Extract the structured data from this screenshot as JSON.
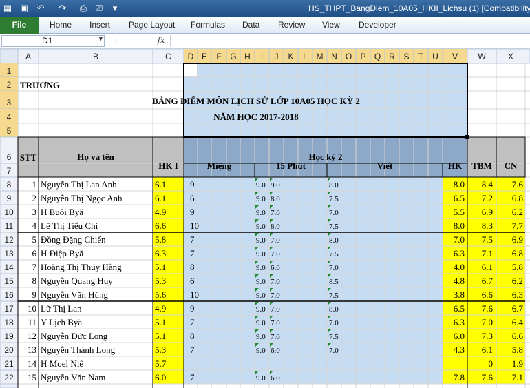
{
  "window": {
    "title": "HS_THPT_BangDiem_10A05_HKII_Lichsu (1)  [Compatibility"
  },
  "quick_access": {
    "save_icon": "save-icon",
    "undo_icon": "undo-icon",
    "redo_icon": "redo-icon",
    "print_preview_icon": "print-preview-icon",
    "print_icon": "print-icon",
    "customize_icon": "chevron-down-icon"
  },
  "ribbon": {
    "file_label": "File",
    "tabs": [
      "Home",
      "Insert",
      "Page Layout",
      "Formulas",
      "Data",
      "Review",
      "View",
      "Developer"
    ]
  },
  "formula_bar": {
    "name_box": "D1",
    "fx_label": "fx",
    "formula": ""
  },
  "columns": [
    "A",
    "B",
    "C",
    "D",
    "E",
    "F",
    "G",
    "H",
    "I",
    "J",
    "K",
    "L",
    "M",
    "N",
    "O",
    "P",
    "Q",
    "R",
    "S",
    "T",
    "U",
    "V",
    "W",
    "X"
  ],
  "row_numbers": [
    "1",
    "2",
    "3",
    "4",
    "5",
    "6",
    "7",
    "8",
    "9",
    "10",
    "11",
    "12",
    "13",
    "14",
    "15",
    "16",
    "17",
    "18",
    "19",
    "20",
    "21",
    "22"
  ],
  "sheet": {
    "school_label": "TRƯỜNG",
    "title": "BẢNG ĐIỂM MÔN LỊCH SỬ LỚP 10A05 HỌC KỲ 2",
    "subtitle": "NĂM HỌC 2017-2018",
    "headers": {
      "stt": "STT",
      "name": "Họ và tên",
      "hk1": "HK I",
      "semester": "Học kỳ 2",
      "mieng": "Miệng",
      "phut15": "15 Phút",
      "viet": "Viết",
      "hk": "HK",
      "tbm": "TBM",
      "cn": "CN"
    },
    "students": [
      {
        "stt": "1",
        "name": "Nguyễn Thị Lan Anh",
        "hk1": "6.1",
        "mieng": "9",
        "p15a": "9.0",
        "p15b": "9.0",
        "viet": "8.0",
        "hk": "8.0",
        "tbm": "8.4",
        "cn": "7.6"
      },
      {
        "stt": "2",
        "name": "Nguyễn Thị Ngọc Anh",
        "hk1": "6.1",
        "mieng": "6",
        "p15a": "9.0",
        "p15b": "8.0",
        "viet": "7.5",
        "hk": "6.5",
        "tbm": "7.2",
        "cn": "6.8"
      },
      {
        "stt": "3",
        "name": "H Buôi Byă",
        "hk1": "4.9",
        "mieng": "9",
        "p15a": "9.0",
        "p15b": "7.0",
        "viet": "7.0",
        "hk": "5.5",
        "tbm": "6.9",
        "cn": "6.2"
      },
      {
        "stt": "4",
        "name": "Lê Thị Tiểu Chi",
        "hk1": "6.6",
        "mieng": "10",
        "p15a": "9.0",
        "p15b": "8.0",
        "viet": "7.5",
        "hk": "8.0",
        "tbm": "8.3",
        "cn": "7.7"
      },
      {
        "stt": "5",
        "name": "Đồng Đặng Chiến",
        "hk1": "5.8",
        "mieng": "7",
        "p15a": "9.0",
        "p15b": "7.0",
        "viet": "8.0",
        "hk": "7.0",
        "tbm": "7.5",
        "cn": "6.9"
      },
      {
        "stt": "6",
        "name": "H Điệp Byă",
        "hk1": "6.3",
        "mieng": "7",
        "p15a": "9.0",
        "p15b": "7.0",
        "viet": "7.5",
        "hk": "6.3",
        "tbm": "7.1",
        "cn": "6.8"
      },
      {
        "stt": "7",
        "name": "Hoàng Thị Thúy Hằng",
        "hk1": "5.1",
        "mieng": "8",
        "p15a": "9.0",
        "p15b": "6.0",
        "viet": "7.0",
        "hk": "4.0",
        "tbm": "6.1",
        "cn": "5.8"
      },
      {
        "stt": "8",
        "name": "Nguyễn Quang Huy",
        "hk1": "5.3",
        "mieng": "6",
        "p15a": "9.0",
        "p15b": "7.0",
        "viet": "8.5",
        "hk": "4.8",
        "tbm": "6.7",
        "cn": "6.2"
      },
      {
        "stt": "9",
        "name": "Nguyễn Văn Hùng",
        "hk1": "5.6",
        "mieng": "10",
        "p15a": "9.0",
        "p15b": "7.0",
        "viet": "7.5",
        "hk": "3.8",
        "tbm": "6.6",
        "cn": "6.3"
      },
      {
        "stt": "10",
        "name": "Lữ Thị Lan",
        "hk1": "4.9",
        "mieng": "9",
        "p15a": "9.0",
        "p15b": "7.0",
        "viet": "8.0",
        "hk": "6.5",
        "tbm": "7.6",
        "cn": "6.7"
      },
      {
        "stt": "11",
        "name": "Y Lịch Byă",
        "hk1": "5.1",
        "mieng": "7",
        "p15a": "9.0",
        "p15b": "7.0",
        "viet": "7.0",
        "hk": "6.3",
        "tbm": "7.0",
        "cn": "6.4"
      },
      {
        "stt": "12",
        "name": "Nguyễn Đức Long",
        "hk1": "5.1",
        "mieng": "8",
        "p15a": "9.0",
        "p15b": "7.0",
        "viet": "7.5",
        "hk": "6.0",
        "tbm": "7.3",
        "cn": "6.6"
      },
      {
        "stt": "13",
        "name": "Nguyễn Thành Long",
        "hk1": "5.3",
        "mieng": "7",
        "p15a": "9.0",
        "p15b": "6.0",
        "viet": "7.0",
        "hk": "4.3",
        "tbm": "6.1",
        "cn": "5.8"
      },
      {
        "stt": "14",
        "name": "H Moel Niê",
        "hk1": "5.7",
        "mieng": "",
        "p15a": "",
        "p15b": "",
        "viet": "",
        "hk": "",
        "tbm": "0",
        "cn": "1.9"
      },
      {
        "stt": "15",
        "name": "Nguyễn Văn Nam",
        "hk1": "6.0",
        "mieng": "7",
        "p15a": "9.0",
        "p15b": "6.0",
        "viet": "",
        "hk": "7.8",
        "tbm": "7.6",
        "cn": "7.1"
      }
    ]
  },
  "colors": {
    "title_bar": "#2b5f99",
    "file_tab": "#2f7d32",
    "hk1_fill": "#ffff00",
    "header_fill": "#c0c0c0",
    "semester_fill": "#8ea9c8",
    "selection_fill": "#c6dcf2",
    "grid": "#d4d4d4"
  }
}
